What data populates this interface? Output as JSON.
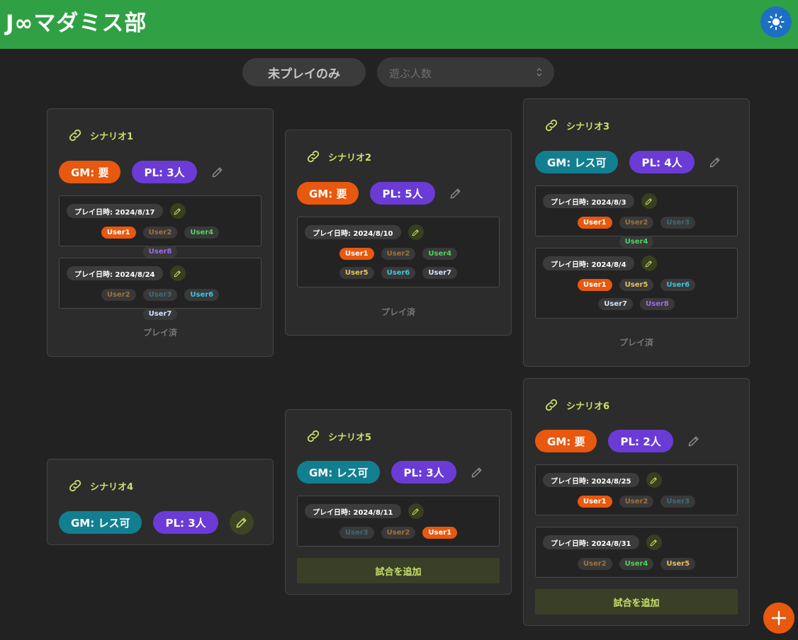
{
  "app": {
    "title": "J∞マダミス部",
    "theme_icon": "sun-icon",
    "add_icon": "plus-icon"
  },
  "filters": {
    "unplayed_label": "未プレイのみ",
    "players_placeholder": "遊ぶ人数"
  },
  "colors": {
    "header": "#30a045",
    "gm_required": "#e8580e",
    "gm_optional": "#127f91",
    "pl": "#6b3bd6",
    "accent": "#c8e06a",
    "users": {
      "User1": {
        "bg": "#e8580e",
        "fg": "#ffffff"
      },
      "User2": {
        "bg": "#393939",
        "fg": "#a0713d"
      },
      "User3": {
        "bg": "#393939",
        "fg": "#3f6a75"
      },
      "User4": {
        "bg": "#393939",
        "fg": "#4fd35a"
      },
      "User5": {
        "bg": "#393939",
        "fg": "#e8c25a"
      },
      "User6": {
        "bg": "#393939",
        "fg": "#3ec3e0"
      },
      "User7": {
        "bg": "#393939",
        "fg": "#cfe3ff"
      },
      "User8": {
        "bg": "#393939",
        "fg": "#9b6ce8"
      }
    }
  },
  "scenarios": [
    {
      "title": "シナリオ1",
      "gm": "GM: 要",
      "gm_type": "required",
      "pl": "PL: 3人",
      "sessions": [
        {
          "date": "プレイ日時: 2024/8/17",
          "users": [
            "User1",
            "User2",
            "User4",
            "User8"
          ]
        },
        {
          "date": "プレイ日時: 2024/8/24",
          "users": [
            "User2",
            "User3",
            "User6",
            "User7"
          ]
        }
      ],
      "status": "プレイ済"
    },
    {
      "title": "シナリオ2",
      "gm": "GM: 要",
      "gm_type": "required",
      "pl": "PL: 5人",
      "sessions": [
        {
          "date": "プレイ日時: 2024/8/10",
          "users": [
            "User1",
            "User2",
            "User4",
            "User5",
            "User6",
            "User7"
          ]
        }
      ],
      "status": "プレイ済"
    },
    {
      "title": "シナリオ3",
      "gm": "GM: レス可",
      "gm_type": "optional",
      "pl": "PL: 4人",
      "sessions": [
        {
          "date": "プレイ日時: 2024/8/3",
          "users": [
            "User1",
            "User2",
            "User3",
            "User4"
          ]
        },
        {
          "date": "プレイ日時: 2024/8/4",
          "users": [
            "User1",
            "User5",
            "User6",
            "User7",
            "User8"
          ]
        }
      ],
      "status": "プレイ済"
    },
    {
      "title": "シナリオ4",
      "gm": "GM: レス可",
      "gm_type": "optional",
      "pl": "PL: 3人",
      "sessions": [],
      "status": ""
    },
    {
      "title": "シナリオ5",
      "gm": "GM: レス可",
      "gm_type": "optional",
      "pl": "PL: 3人",
      "sessions": [
        {
          "date": "プレイ日時: 2024/8/11",
          "users": [
            "User3",
            "User2",
            "User1"
          ]
        }
      ],
      "add_label": "試合を追加"
    },
    {
      "title": "シナリオ6",
      "gm": "GM: 要",
      "gm_type": "required",
      "pl": "PL: 2人",
      "sessions": [
        {
          "date": "プレイ日時: 2024/8/25",
          "users": [
            "User1",
            "User2",
            "User3"
          ]
        },
        {
          "date": "プレイ日時: 2024/8/31",
          "users": [
            "User2",
            "User4",
            "User5"
          ]
        }
      ],
      "add_label": "試合を追加"
    }
  ]
}
